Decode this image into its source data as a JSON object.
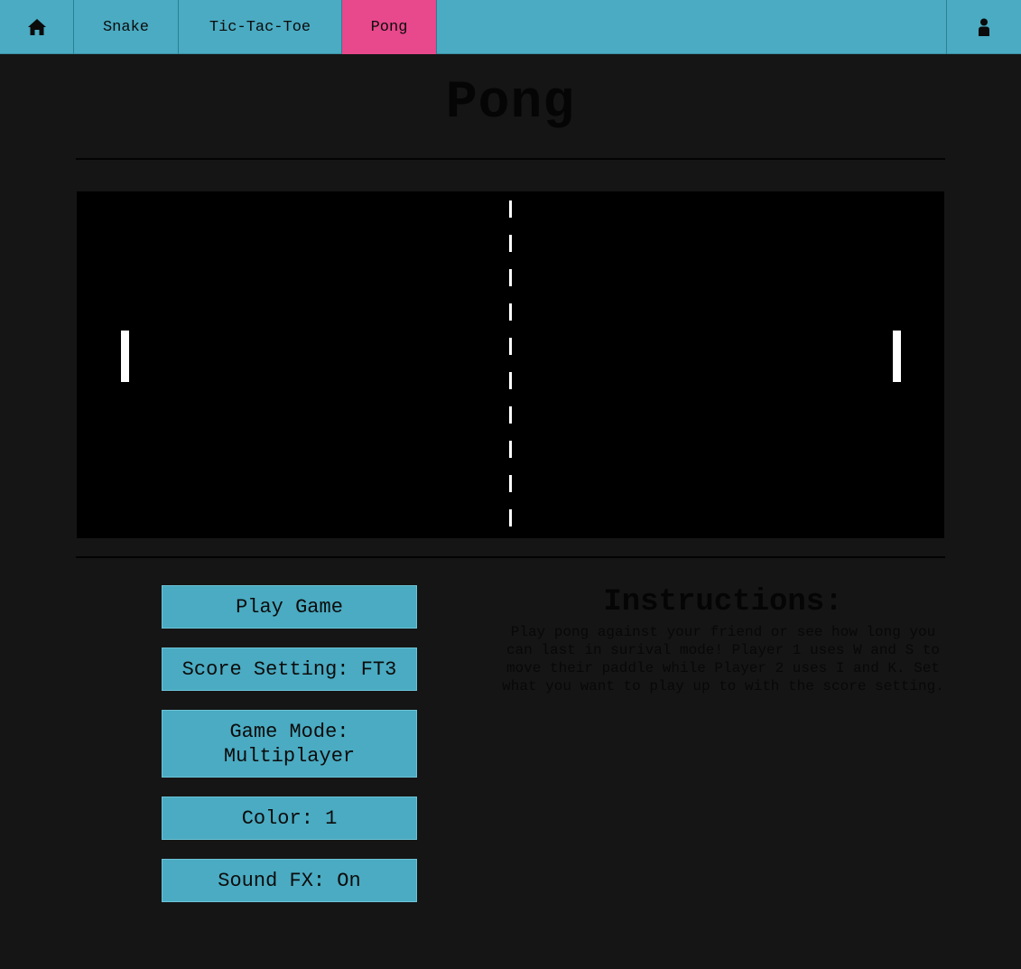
{
  "nav": {
    "home_icon": "home-icon",
    "user_icon": "user-icon",
    "tabs": [
      {
        "label": "Snake"
      },
      {
        "label": "Tic-Tac-Toe"
      },
      {
        "label": "Pong",
        "active": true
      }
    ],
    "active_color": "#e8488c",
    "bar_color": "#4aabc2"
  },
  "page": {
    "title": "Pong"
  },
  "game": {
    "background": "#000000",
    "paddle_color": "#ffffff"
  },
  "controls": {
    "play_label": "Play Game",
    "score_label": "Score Setting: FT3",
    "mode_label": "Game Mode:\nMultiplayer",
    "color_label": "Color: 1",
    "sound_label": "Sound FX: On"
  },
  "instructions": {
    "title": "Instructions:",
    "text": "Play pong against your friend or see how long you can last in surival mode! Player 1 uses W and S to move their paddle while Player 2 uses I and K. Set what you want to play up to with the score setting."
  }
}
